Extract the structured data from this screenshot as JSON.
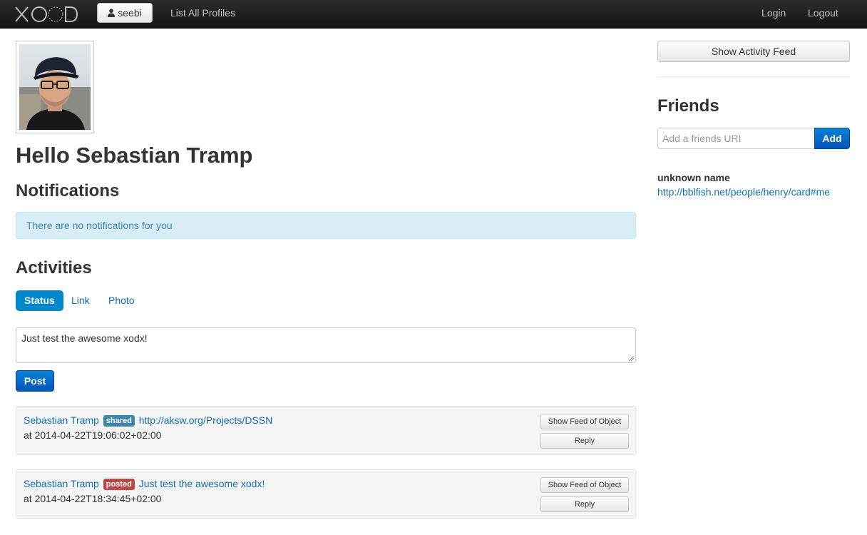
{
  "navbar": {
    "brand": "XOĐX",
    "user_button": "seebi",
    "list_profiles": "List All Profiles",
    "login": "Login",
    "logout": "Logout"
  },
  "profile": {
    "greeting": "Hello Sebastian Tramp"
  },
  "notifications": {
    "heading": "Notifications",
    "empty_message": "There are no notifications for you"
  },
  "activities": {
    "heading": "Activities",
    "tabs": [
      {
        "label": "Status",
        "active": true
      },
      {
        "label": "Link",
        "active": false
      },
      {
        "label": "Photo",
        "active": false
      }
    ],
    "status_text": "Just test the awesome xodx!",
    "post_label": "Post",
    "items": [
      {
        "actor": "Sebastian Tramp",
        "verb": "shared",
        "object": "http://aksw.org/Projects/DSSN",
        "time": "at 2014-04-22T19:06:02+02:00",
        "feed_label": "Show Feed of Object",
        "reply_label": "Reply"
      },
      {
        "actor": "Sebastian Tramp",
        "verb": "posted",
        "object": "Just test the awesome xodx!",
        "time": "at 2014-04-22T18:34:45+02:00",
        "feed_label": "Show Feed of Object",
        "reply_label": "Reply"
      }
    ]
  },
  "sidebar": {
    "feed_button": "Show Activity Feed",
    "friends_heading": "Friends",
    "friend_placeholder": "Add a friends URI",
    "add_label": "Add",
    "friends": [
      {
        "name": "unknown name",
        "uri": "http://bblfish.net/people/henry/card#me"
      }
    ]
  },
  "colors": {
    "accent": "#0088cc",
    "link": "#0e70b8",
    "label_shared": "#3a87ad",
    "label_posted": "#b94a48",
    "alert_bg": "#d9edf7"
  }
}
